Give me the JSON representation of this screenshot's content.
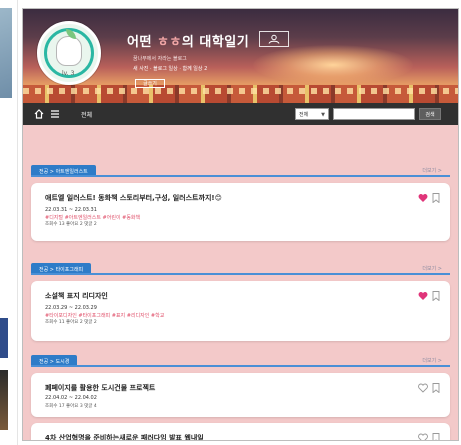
{
  "blog": {
    "title_prefix": "어떤 ",
    "title_accent": "ㅎㅎ",
    "title_suffix": "의 대학일기",
    "subtitle": "꿈나무에서 자라는 블로그",
    "stats": "새 사진 · 블로그 일상 · 함께 일상 2",
    "level": "lv. 3",
    "write_label": "글쓰기"
  },
  "nav": {
    "all_label": "전체",
    "search_option": "전체",
    "search_placeholder": "",
    "search_button": "검색"
  },
  "sections": [
    {
      "tag": "전공 > 아트엔일러스트",
      "more": "더보기 >",
      "post": {
        "title": "애트엘 일러스트! 동화책 스토리부터,구성, 일러스트까지!😊",
        "date": "22.03.31 ~ 22.03.31",
        "tags": "#디지털 #아트엔일러스트 #어린이 #동화책",
        "meta": "조회수 13 좋아요 2 댓글 2",
        "liked": true
      }
    },
    {
      "tag": "전공 > 타이포그래피",
      "more": "더보기 >",
      "post": {
        "title": "소설책 표지 리디자인",
        "date": "22.03.29 ~ 22.03.29",
        "tags": "#타이포디자인 #타이포그래피 #표지 #리디자인 #학교",
        "meta": "조회수 11 좋아요 2 댓글 2",
        "liked": true
      }
    },
    {
      "tag": "전공 > 도시경",
      "more": "더보기 >",
      "posts": [
        {
          "title": "폐페이지를 활용한 도시건물 프로젝트",
          "date": "22.04.02 ~ 22.04.02",
          "meta": "조회수 17 좋아요 3 댓글 4",
          "liked": false
        },
        {
          "title": "4차 산업혁명을 준비하는새로운 패러다임 발표 웹내일",
          "liked": false
        }
      ]
    }
  ],
  "colors": {
    "heart_active": "#e0357a",
    "heart_inactive": "#999999",
    "section_tag": "#2e7cc8",
    "background": "#f3c9c9"
  },
  "icons": [
    "home-icon",
    "menu-icon",
    "profile-card-icon",
    "heart-icon",
    "bookmark-icon"
  ]
}
